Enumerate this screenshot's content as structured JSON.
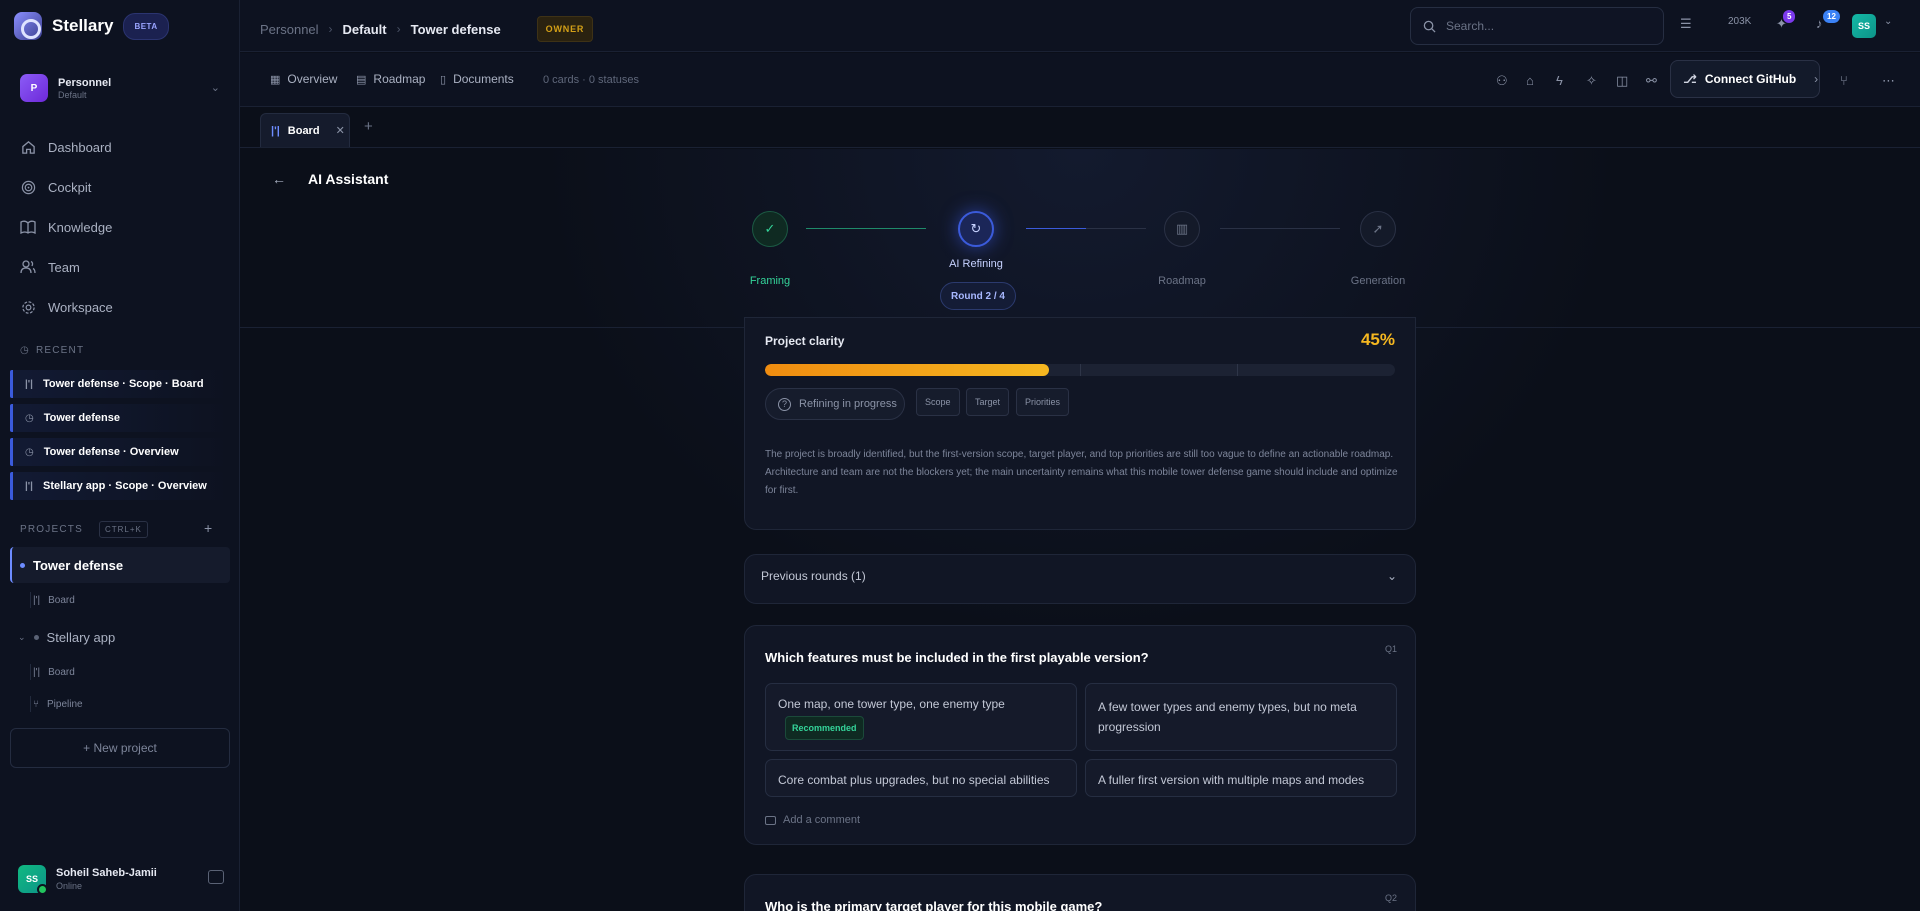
{
  "app": {
    "name": "Stellary",
    "badge": "BETA"
  },
  "workspace": {
    "initial": "P",
    "name": "Personnel",
    "sub": "Default"
  },
  "nav": {
    "dashboard": "Dashboard",
    "cockpit": "Cockpit",
    "knowledge": "Knowledge",
    "team": "Team",
    "workspace": "Workspace"
  },
  "recent": {
    "label": "RECENT",
    "items": [
      "Tower defense · Scope · Board",
      "Tower defense",
      "Tower defense · Overview",
      "Stellary app · Scope · Overview"
    ]
  },
  "projects": {
    "label": "PROJECTS",
    "shortcut": "CTRL+K",
    "tower": {
      "name": "Tower defense",
      "sub_board": "Board"
    },
    "stellary": {
      "name": "Stellary app",
      "sub_board": "Board",
      "sub_pipeline": "Pipeline"
    },
    "new_project": "+ New project"
  },
  "user": {
    "initials": "SS",
    "name": "Soheil Saheb-Jamii",
    "status": "Online"
  },
  "topbar": {
    "crumb1": "Personnel",
    "crumb2": "Default",
    "crumb3": "Tower defense",
    "owner": "OWNER",
    "search_placeholder": "Search...",
    "count": "203K",
    "badge_a": "5",
    "badge_b": "12",
    "avatar": "SS"
  },
  "subbar": {
    "overview": "Overview",
    "roadmap": "Roadmap",
    "documents": "Documents",
    "meta": "0  cards  ·  0 statuses",
    "connect": "Connect GitHub"
  },
  "tabs": {
    "board": "Board"
  },
  "assistant": {
    "title": "AI Assistant",
    "steps": {
      "framing": "Framing",
      "refining": "AI Refining",
      "round": "Round 2 / 4",
      "roadmap": "Roadmap",
      "generation": "Generation"
    }
  },
  "clarity": {
    "title": "Project clarity",
    "percent_label": "45%",
    "percent": 0.45,
    "status": "Refining in progress",
    "tags": [
      "Scope",
      "Target",
      "Priorities"
    ],
    "text": "The project is broadly identified, but the first-version scope, target player, and top priorities are still too vague to define an actionable roadmap. Architecture and team are not the blockers yet; the main uncertainty remains what this mobile tower defense game should include and optimize for first."
  },
  "previous_rounds": "Previous rounds (1)",
  "q1": {
    "number": "Q1",
    "title": "Which features must be included in the first playable version?",
    "options": [
      "One map, one tower type, one enemy type",
      "A few tower types and enemy types, but no meta progression",
      "Core combat plus upgrades, but no special abilities",
      "A fuller first version with multiple maps and modes"
    ],
    "recommended": "Recommended",
    "comment": "Add a comment"
  },
  "q2": {
    "number": "Q2",
    "title": "Who is the primary target player for this mobile game?"
  },
  "colors": {
    "accent": "#6d8cff",
    "success": "#34d399",
    "warning": "#f5b720"
  }
}
